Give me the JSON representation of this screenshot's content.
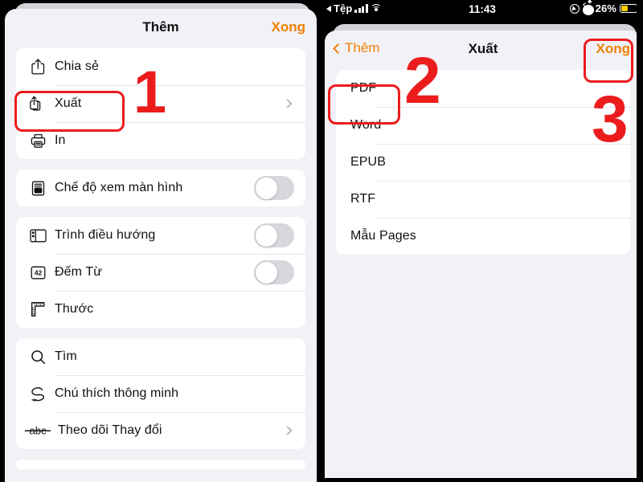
{
  "left_panel": {
    "nav": {
      "title": "Thêm",
      "done_label": "Xong"
    },
    "groups": [
      {
        "rows": [
          {
            "icon": "share-icon",
            "label": "Chia sẻ",
            "accessory": "none"
          },
          {
            "icon": "export-icon",
            "label": "Xuất",
            "accessory": "chevron"
          },
          {
            "icon": "print-icon",
            "label": "In",
            "accessory": "none"
          }
        ]
      },
      {
        "rows": [
          {
            "icon": "document-view-icon",
            "label": "Chế độ xem màn hình",
            "accessory": "toggle",
            "toggle_on": false
          }
        ]
      },
      {
        "rows": [
          {
            "icon": "navigator-icon",
            "label": "Trình điều hướng",
            "accessory": "toggle",
            "toggle_on": false
          },
          {
            "icon": "word-count-icon",
            "label": "Đếm Từ",
            "accessory": "toggle",
            "toggle_on": false
          },
          {
            "icon": "ruler-icon",
            "label": "Thước",
            "accessory": "none"
          }
        ]
      },
      {
        "rows": [
          {
            "icon": "search-icon",
            "label": "Tìm",
            "accessory": "none"
          },
          {
            "icon": "smart-annotation-icon",
            "label": "Chú thích thông minh",
            "accessory": "none"
          },
          {
            "icon": "track-changes-icon",
            "label": "Theo dõi Thay đổi",
            "accessory": "chevron"
          }
        ]
      }
    ]
  },
  "right_panel": {
    "statusbar": {
      "back_app": "Tệp",
      "time": "11:43",
      "battery_percent": "26%",
      "battery_color": "#ffcc00",
      "signal_icon": "cellular-bars-icon",
      "wifi_icon": "wifi-icon",
      "location_icon": "location-arrow-icon",
      "alarm_icon": "alarm-clock-icon"
    },
    "nav": {
      "back_label": "Thêm",
      "title": "Xuất",
      "done_label": "Xong"
    },
    "groups": [
      {
        "rows": [
          {
            "label": "PDF"
          },
          {
            "label": "Word"
          },
          {
            "label": "EPUB"
          },
          {
            "label": "RTF"
          },
          {
            "label": "Mẫu Pages"
          }
        ]
      }
    ]
  },
  "annotations": {
    "color": "#ec1c1c",
    "steps": [
      {
        "number": "1",
        "target": "Xuất"
      },
      {
        "number": "2",
        "target": "PDF"
      },
      {
        "number": "3",
        "target": "Xong"
      }
    ]
  }
}
